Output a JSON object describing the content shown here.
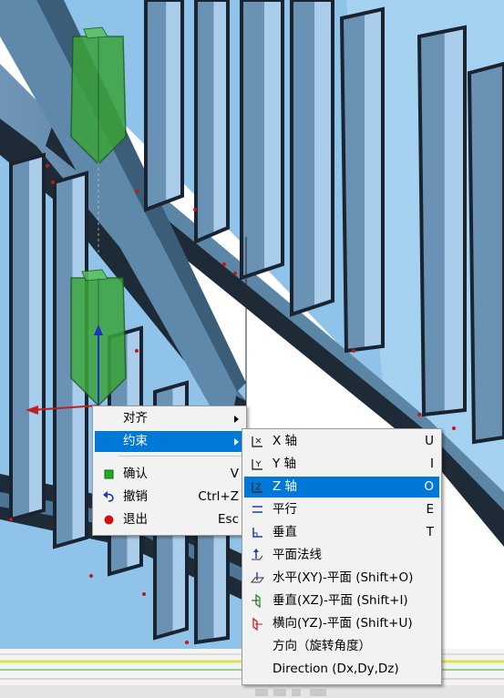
{
  "menu1": {
    "items": [
      {
        "label": "对齐",
        "submenu": true
      },
      {
        "label": "约束",
        "submenu": true,
        "highlighted": true
      },
      {
        "label": "确认",
        "shortcut": "V",
        "icon": "green-square-icon"
      },
      {
        "label": "撤销",
        "shortcut": "Ctrl+Z",
        "icon": "undo-arrow-icon"
      },
      {
        "label": "退出",
        "shortcut": "Esc",
        "icon": "red-circle-icon"
      }
    ]
  },
  "menu2": {
    "items": [
      {
        "label": "X 轴",
        "shortcut": "U",
        "icon": "x-axis-icon"
      },
      {
        "label": "Y 轴",
        "shortcut": "I",
        "icon": "y-axis-icon"
      },
      {
        "label": "Z 轴",
        "shortcut": "O",
        "icon": "z-axis-icon",
        "highlighted": true
      },
      {
        "label": "平行",
        "shortcut": "E",
        "icon": "parallel-icon"
      },
      {
        "label": "垂直",
        "shortcut": "T",
        "icon": "perpendicular-icon"
      },
      {
        "label": "平面法线",
        "shortcut": "",
        "icon": "plane-normal-icon"
      },
      {
        "label": "水平(XY)-平面 (Shift+O)",
        "shortcut": "",
        "icon": "xy-plane-icon"
      },
      {
        "label": "垂直(XZ)-平面 (Shift+I)",
        "shortcut": "",
        "icon": "xz-plane-icon"
      },
      {
        "label": "横向(YZ)-平面 (Shift+U)",
        "shortcut": "",
        "icon": "yz-plane-icon"
      },
      {
        "label": "方向（旋转角度）",
        "shortcut": "",
        "icon": ""
      },
      {
        "label": "Direction (Dx,Dy,Dz)",
        "shortcut": "",
        "icon": ""
      }
    ]
  },
  "colors": {
    "menu_bg": "#f2f2f2",
    "highlight": "#0078d7",
    "sky": "#8fc3ea",
    "steel_top": "#5f87a8",
    "steel_dark": "#1c2733",
    "guide_green": "#3aa33a"
  }
}
